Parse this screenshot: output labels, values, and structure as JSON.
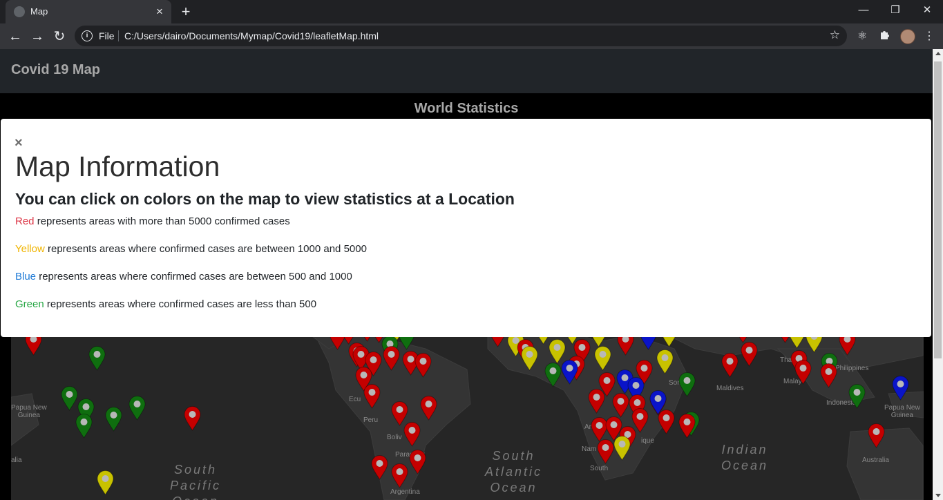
{
  "browser": {
    "tab_title": "Map",
    "new_tab_symbol": "+",
    "scheme_label": "File",
    "url": "C:/Users/dairo/Documents/Mymap/Covid19/leafletMap.html",
    "icons": [
      "back-arrow-icon",
      "forward-arrow-icon",
      "reload-icon",
      "info-icon",
      "star-icon",
      "react-devtools-icon",
      "extensions-puzzle-icon",
      "profile-avatar",
      "more-menu-icon",
      "minimize-icon",
      "restore-icon",
      "close-icon"
    ]
  },
  "navbar": {
    "brand": "Covid 19 Map"
  },
  "section": {
    "title": "World Statistics"
  },
  "modal": {
    "close_symbol": "×",
    "title": "Map Information",
    "subtitle": "You can click on colors on the map to view statistics at a Location",
    "legend": [
      {
        "color_word": "Red",
        "text": " represents areas with more than 5000 confirmed cases",
        "color": "#dc3545"
      },
      {
        "color_word": "Yellow",
        "text": " represents areas where confirmed cases are between 1000 and 5000",
        "color": "#f0b400"
      },
      {
        "color_word": "Blue",
        "text": " represents areas where confirmed cases are between 500 and 1000",
        "color": "#1e7ad6"
      },
      {
        "color_word": "Green",
        "text": " represents areas where confirmed cases are less than 500",
        "color": "#28a745"
      }
    ]
  },
  "map_labels": {
    "papua_left": "Papua New\nGuinea",
    "ecuador": "Ecu",
    "peru": "Peru",
    "bolivia": "Boliv",
    "paraguay": "Paraguay",
    "argentina": "Argentina",
    "south_pacific": "South\nPacific\nOcean",
    "south_atlantic": "South\nAtlantic\nOcean",
    "indian_ocean": "Indian\nOcean",
    "angola": "Angola",
    "namibia": "Nam",
    "mozambique": "ique",
    "south_africa": "South",
    "somalia": "Somalia",
    "maldives": "Maldives",
    "thailand": "Thai",
    "malaysia": "Malay",
    "philippines": "Philippines",
    "indonesia": "Indonesia",
    "papua_right": "Papua New\nGuinea",
    "australia": "Australia",
    "alia": "alia"
  },
  "marker_colors": {
    "red": "#c40000",
    "yellow": "#c8c200",
    "blue": "#0a14c8",
    "green": "#0f6e0f"
  }
}
